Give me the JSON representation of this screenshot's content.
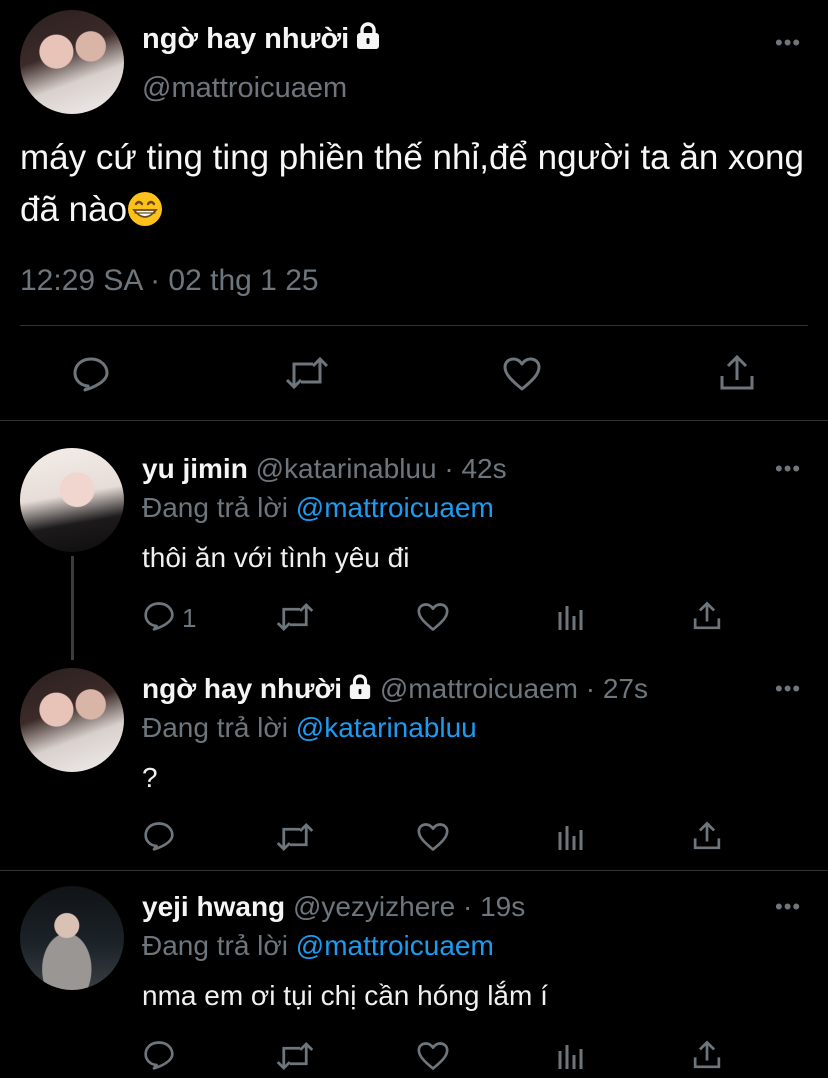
{
  "main_tweet": {
    "name": "ngờ hay nhười",
    "handle": "@mattroicuaem",
    "text": "máy cứ ting ting phiền thế nhỉ,để người ta ăn xong đã nào",
    "emoji": "grinning-face-emoji",
    "timestamp": "12:29 SA · 02 thg 1 25"
  },
  "replies": [
    {
      "name": "yu jimin",
      "handle": "@katarinabluu",
      "sep": " · ",
      "time": "42s",
      "replying_label": "Đang trả lời ",
      "replying_to": "@mattroicuaem",
      "text": "thôi ăn với tình yêu đi",
      "reply_count": "1"
    },
    {
      "name": "ngờ hay nhười",
      "handle": "@mattroicuaem",
      "sep": " · ",
      "time": "27s",
      "replying_label": "Đang trả lời ",
      "replying_to": "@katarinabluu",
      "text": "?",
      "reply_count": ""
    },
    {
      "name": "yeji hwang",
      "handle": "@yezyizhere",
      "sep": " · ",
      "time": "19s",
      "replying_label": "Đang trả lời ",
      "replying_to": "@mattroicuaem",
      "text": "nma em ơi tụi chị cần hóng lắm í",
      "reply_count": ""
    }
  ],
  "more_label": "•••",
  "colors": {
    "background": "#000000",
    "muted": "#6e767d",
    "link": "#1d9bf0",
    "divider": "#2f3336"
  }
}
